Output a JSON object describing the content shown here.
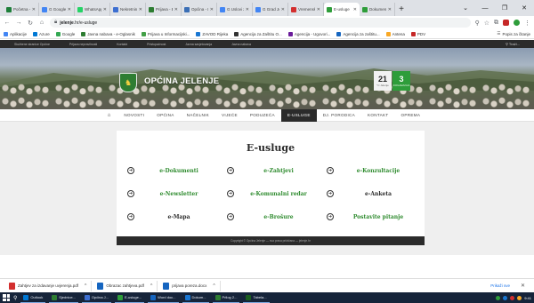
{
  "browser": {
    "tabs": [
      {
        "label": "Početna - Jel",
        "color": "#1e7f3a"
      },
      {
        "label": "G Google pretr",
        "color": "#4285f4"
      },
      {
        "label": "WhatsApp",
        "color": "#25d366"
      },
      {
        "label": "Nekretnine",
        "color": "#3d6fd1"
      },
      {
        "label": "Prijava - El",
        "color": "#2e7d32"
      },
      {
        "label": "Općina - Kor",
        "color": "#3b6fb6"
      },
      {
        "label": "G Uslovi za",
        "color": "#4285f4"
      },
      {
        "label": "G Grad Jele",
        "color": "#4285f4"
      },
      {
        "label": "Vremenska",
        "color": "#d32f2f"
      },
      {
        "label": "E-usluge",
        "color": "#2e9d3a",
        "active": true
      },
      {
        "label": "Dokumenti",
        "color": "#2e9d3a"
      }
    ],
    "new_tab": "+",
    "window_controls": [
      "⌄",
      "—",
      "❐",
      "✕"
    ],
    "url_host": "jelenje",
    "url_path": ".hr/e-usluge",
    "bookmarks": [
      {
        "label": "Aplikacije",
        "color": "#4285f4"
      },
      {
        "label": "Azure",
        "color": "#0078d4"
      },
      {
        "label": "Google",
        "color": "#34a853"
      },
      {
        "label": "Javna nabava - e-Oglasnik",
        "color": "#2e7d32"
      },
      {
        "label": "Prijava u Informacijski...",
        "color": "#43a047"
      },
      {
        "label": "ZAVOD Rijeka",
        "color": "#1976d2"
      },
      {
        "label": "Agencija za Zaštitu O...",
        "color": "#333333"
      },
      {
        "label": "Agencija - Ugovori...",
        "color": "#6a1b9a"
      },
      {
        "label": "Agencija za zaštitu...",
        "color": "#1565c0"
      },
      {
        "label": "Antena",
        "color": "#f9a825"
      },
      {
        "label": "PDV",
        "color": "#c62828"
      }
    ],
    "bookmarks_other": "Popis za čitanje"
  },
  "site": {
    "top_links": [
      "Službene stranice Općine",
      "Prijava nepravilnosti",
      "Kontakt",
      "Pristupačnost",
      "Javna savjetovanja",
      "Javna nabava"
    ],
    "search_label": "⚲ Traži...",
    "title": "OPĆINA JELENJE",
    "weather_value": "21",
    "weather_sub": "°C Jelenje",
    "day_value": "3",
    "day_sub": "DOGAĐANJA",
    "nav": [
      "NOVOSTI",
      "OPĆINA",
      "NAČELNIK",
      "VIJEĆE",
      "PODUZEĆA",
      "E-USLUGE",
      "DJ. PORODICA",
      "KONTAKT",
      "OPREMA"
    ],
    "nav_active_index": 5,
    "eusluge_title": "E-usluge",
    "services": [
      {
        "label": "e-Dokumenti",
        "style": "green"
      },
      {
        "label": "e-Zahtjevi",
        "style": "green"
      },
      {
        "label": "e-Konzultacije",
        "style": "green"
      },
      {
        "label": "e-Newsletter",
        "style": "green"
      },
      {
        "label": "e-Komunalni redar",
        "style": "green"
      },
      {
        "label": "e-Anketa",
        "style": "dark"
      },
      {
        "label": "e-Mapa",
        "style": "dark"
      },
      {
        "label": "e-Brošure",
        "style": "green"
      },
      {
        "label": "Postavite pitanje",
        "style": "green"
      }
    ],
    "footer_text": "Copyright © Općina Jelenje — sva prava pridržana — jelenje.hr"
  },
  "downloads": {
    "items": [
      {
        "name": "Zahtjev za izdavanje uvjerenja.pdf",
        "color": "#d32f2f"
      },
      {
        "name": "Obrazac zahtjeva.pdf",
        "color": "#1565c0"
      },
      {
        "name": "prijava poreza.docx",
        "color": "#1565c0"
      }
    ],
    "show_all": "Prikaži sve",
    "close": "✕"
  },
  "taskbar": {
    "apps": [
      {
        "label": "Outlook",
        "color": "#0078d4"
      },
      {
        "label": "Sjednice...",
        "color": "#2e7d32"
      },
      {
        "label": "Općina J...",
        "color": "#3d6fd1"
      },
      {
        "label": "E-usluge...",
        "color": "#2e9d3a"
      },
      {
        "label": "Word doc...",
        "color": "#1565c0"
      },
      {
        "label": "Dokum...",
        "color": "#1976d2"
      },
      {
        "label": "Prilog 2...",
        "color": "#2e7d32"
      },
      {
        "label": "Tabela...",
        "color": "#1b5e20"
      }
    ],
    "clock": "9:41"
  }
}
